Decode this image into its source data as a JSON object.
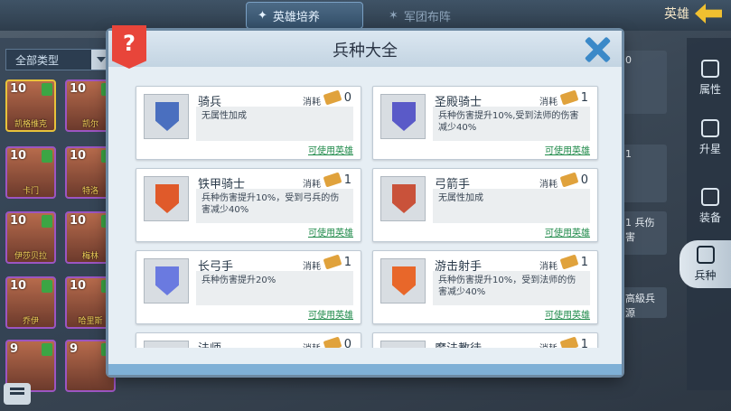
{
  "topbar": {
    "tab_active": "英雄培养",
    "tab_second": "军团布阵",
    "back_label": "英雄"
  },
  "filter": {
    "value": "全部类型"
  },
  "heroes": [
    {
      "level": "10",
      "name": "凯格维克"
    },
    {
      "level": "10",
      "name": "凯尔"
    },
    {
      "level": "10",
      "name": "卡门"
    },
    {
      "level": "10",
      "name": "特洛"
    },
    {
      "level": "10",
      "name": "伊莎贝拉"
    },
    {
      "level": "10",
      "name": "梅林"
    },
    {
      "level": "10",
      "name": "乔伊"
    },
    {
      "level": "10",
      "name": "哈里斯"
    },
    {
      "level": "9",
      "name": ""
    },
    {
      "level": "9",
      "name": ""
    }
  ],
  "right_nav": {
    "attr": "属性",
    "star": "升星",
    "equip": "装备",
    "troops": "兵种"
  },
  "side_cards": [
    {
      "value": "0"
    },
    {
      "value": "1"
    },
    {
      "value": "1",
      "text": "兵伤害"
    },
    {
      "value": "",
      "text": "高級兵源"
    }
  ],
  "modal": {
    "help_icon": "?",
    "title": "兵种大全",
    "cost_label": "消耗",
    "usable_label": "可使用英雄",
    "units": [
      {
        "name": "骑兵",
        "cost": "0",
        "desc": "无属性加成",
        "color": "#4a6fbf"
      },
      {
        "name": "圣殿骑士",
        "cost": "1",
        "desc": "兵种伤害提升10%,受到法师的伤害减少40%",
        "color": "#5a5ac8"
      },
      {
        "name": "铁甲骑士",
        "cost": "1",
        "desc": "兵种伤害提升10%，受到弓兵的伤害减少40%",
        "color": "#e05a2a"
      },
      {
        "name": "弓箭手",
        "cost": "0",
        "desc": "无属性加成",
        "color": "#c9523a"
      },
      {
        "name": "长弓手",
        "cost": "1",
        "desc": "兵种伤害提升20%",
        "color": "#6a7ae0"
      },
      {
        "name": "游击射手",
        "cost": "1",
        "desc": "兵种伤害提升10%，受到法师的伤害减少40%",
        "color": "#e8672a"
      },
      {
        "name": "法师",
        "cost": "0",
        "desc": "",
        "color": "#8a9aa8"
      },
      {
        "name": "魔法教徒",
        "cost": "1",
        "desc": "",
        "color": "#8a9aa8"
      }
    ]
  }
}
